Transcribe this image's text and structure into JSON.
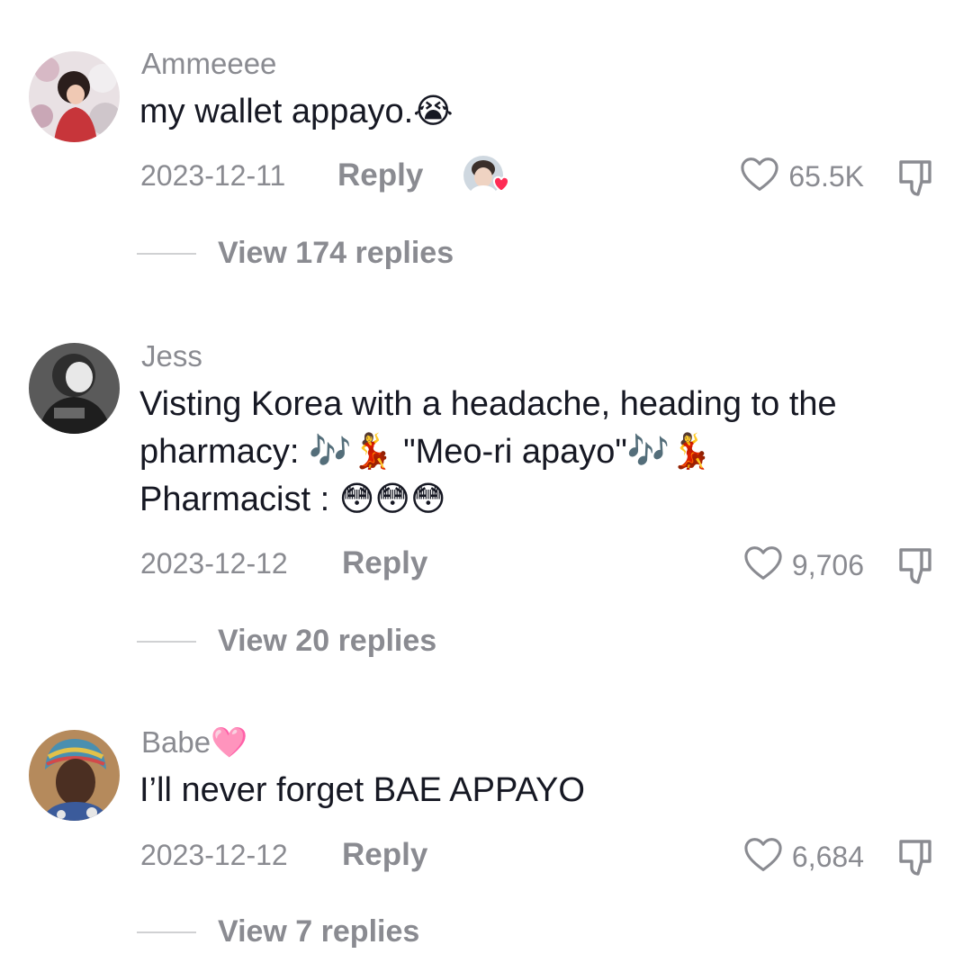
{
  "comments": [
    {
      "username": "Ammeeee",
      "text_lines": [
        "my wallet appayo.😭"
      ],
      "date": "2023-12-11",
      "reply_label": "Reply",
      "likes": "65.5K",
      "replies_label": "View 174 replies",
      "creator_liked": true
    },
    {
      "username": "Jess",
      "text_lines": [
        "Visting Korea with a headache, heading to the",
        "pharmacy: 🎶💃 \"Meo-ri apayo\"🎶💃",
        "Pharmacist : 😳😳😳"
      ],
      "date": "2023-12-12",
      "reply_label": "Reply",
      "likes": "9,706",
      "replies_label": "View 20 replies",
      "creator_liked": false
    },
    {
      "username": "Babe🩷",
      "text_lines": [
        "I’ll never forget BAE APPAYO"
      ],
      "date": "2023-12-12",
      "reply_label": "Reply",
      "likes": "6,684",
      "replies_label": "View 7 replies",
      "creator_liked": false
    }
  ],
  "icons": {
    "like": "heart-outline-icon",
    "dislike": "thumbs-down-icon"
  },
  "colors": {
    "muted": "#8a8b91",
    "text": "#161823",
    "heart_badge": "#fe2c55"
  }
}
